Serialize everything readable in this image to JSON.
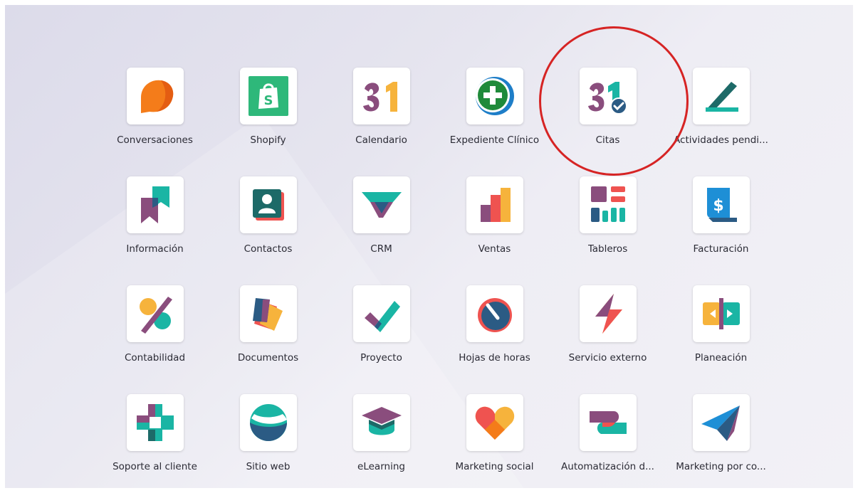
{
  "apps": [
    {
      "label": "Conversaciones",
      "icon": "discuss-icon"
    },
    {
      "label": "Shopify",
      "icon": "shopify-icon"
    },
    {
      "label": "Calendario",
      "icon": "calendar-icon",
      "icon_text": "31"
    },
    {
      "label": "Expediente Clínico",
      "icon": "medical-record-icon"
    },
    {
      "label": "Citas",
      "icon": "appointments-icon",
      "icon_text": "31"
    },
    {
      "label": "Actividades pendi...",
      "icon": "activities-icon"
    },
    {
      "label": "Información",
      "icon": "knowledge-icon"
    },
    {
      "label": "Contactos",
      "icon": "contacts-icon"
    },
    {
      "label": "CRM",
      "icon": "crm-icon"
    },
    {
      "label": "Ventas",
      "icon": "sales-icon"
    },
    {
      "label": "Tableros",
      "icon": "dashboards-icon"
    },
    {
      "label": "Facturación",
      "icon": "invoicing-icon"
    },
    {
      "label": "Contabilidad",
      "icon": "accounting-icon"
    },
    {
      "label": "Documentos",
      "icon": "documents-icon"
    },
    {
      "label": "Proyecto",
      "icon": "project-icon"
    },
    {
      "label": "Hojas de horas",
      "icon": "timesheets-icon"
    },
    {
      "label": "Servicio externo",
      "icon": "field-service-icon"
    },
    {
      "label": "Planeación",
      "icon": "planning-icon"
    },
    {
      "label": "Soporte al cliente",
      "icon": "helpdesk-icon"
    },
    {
      "label": "Sitio web",
      "icon": "website-icon"
    },
    {
      "label": "eLearning",
      "icon": "elearning-icon"
    },
    {
      "label": "Marketing social",
      "icon": "social-marketing-icon"
    },
    {
      "label": "Automatización d...",
      "icon": "marketing-automation-icon"
    },
    {
      "label": "Marketing por co...",
      "icon": "email-marketing-icon"
    }
  ],
  "highlight": {
    "target": "Citas",
    "color": "#d62424"
  },
  "colors": {
    "purple": "#8a4d7d",
    "teal": "#1ab5a4",
    "orange": "#f47c1a",
    "navy": "#2b5b84",
    "yellow": "#f6b33c",
    "red": "#ef5350"
  }
}
